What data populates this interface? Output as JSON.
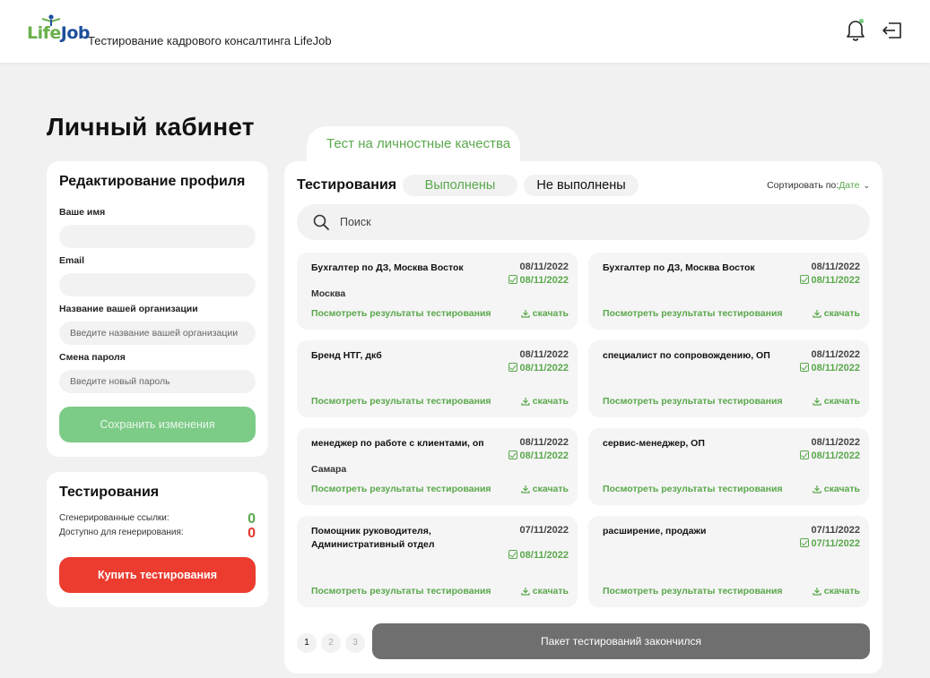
{
  "header": {
    "logo_life": "Life",
    "logo_job": "Job",
    "title": "Тестирование кадрового консалтинга LifeJob"
  },
  "page_title": "Личный кабинет",
  "profile": {
    "title": "Редактирование профиля",
    "name_label": "Ваше имя",
    "name_value": "",
    "email_label": "Email",
    "email_value": "",
    "org_label": "Название вашей организации",
    "org_placeholder": "Введите название вашей организации",
    "password_label": "Смена пароля",
    "password_placeholder": "Введите новый пароль",
    "save_label": "Сохранить изменения"
  },
  "tests_summary": {
    "title": "Тестирования",
    "generated_label": "Сгенерированные ссылки:",
    "generated_value": "0",
    "available_label": "Доступно для генерирования:",
    "available_value": "0",
    "buy_label": "Купить тестирования"
  },
  "main": {
    "top_tab": "Тест на личностные качества",
    "heading": "Тестирования",
    "filter_done": "Выполнены",
    "filter_not_done": "Не выполнены",
    "sort_label": "Сортировать по:",
    "sort_value": "Дате",
    "search_placeholder": "Поиск",
    "results_link": "Посмотреть результаты тестирования",
    "download_link": "скачать",
    "cards": [
      {
        "title": "Бухгалтер по ДЗ, Москва Восток",
        "date_created": "08/11/2022",
        "date_done": "08/11/2022",
        "city": "Москва"
      },
      {
        "title": "Бухгалтер по ДЗ, Москва Восток",
        "date_created": "08/11/2022",
        "date_done": "08/11/2022",
        "city": ""
      },
      {
        "title": "Бренд НТГ, дкб",
        "date_created": "08/11/2022",
        "date_done": "08/11/2022",
        "city": ""
      },
      {
        "title": "специалист по сопровождению, ОП",
        "date_created": "08/11/2022",
        "date_done": "08/11/2022",
        "city": ""
      },
      {
        "title": "менеджер по работе с клиентами, оп",
        "date_created": "08/11/2022",
        "date_done": "08/11/2022",
        "city": "Самара"
      },
      {
        "title": "сервис-менеджер, ОП",
        "date_created": "08/11/2022",
        "date_done": "08/11/2022",
        "city": ""
      },
      {
        "title": "Помощник руководителя, Административный отдел",
        "date_created": "07/11/2022",
        "date_done": "08/11/2022",
        "city": ""
      },
      {
        "title": "расширение, продажи",
        "date_created": "07/11/2022",
        "date_done": "07/11/2022",
        "city": ""
      }
    ],
    "pages": [
      "1",
      "2",
      "3"
    ],
    "current_page": "1",
    "toast": "Пакет тестирований закончился"
  },
  "colors": {
    "accent_green": "#5aa84c",
    "button_green": "#7ccb86",
    "button_red": "#ec3b2f",
    "toast_gray": "#6f6f6f"
  },
  "icons": [
    "bell-icon",
    "logout-icon",
    "search-icon",
    "checkbox-icon",
    "download-icon",
    "chevron-down-icon"
  ]
}
